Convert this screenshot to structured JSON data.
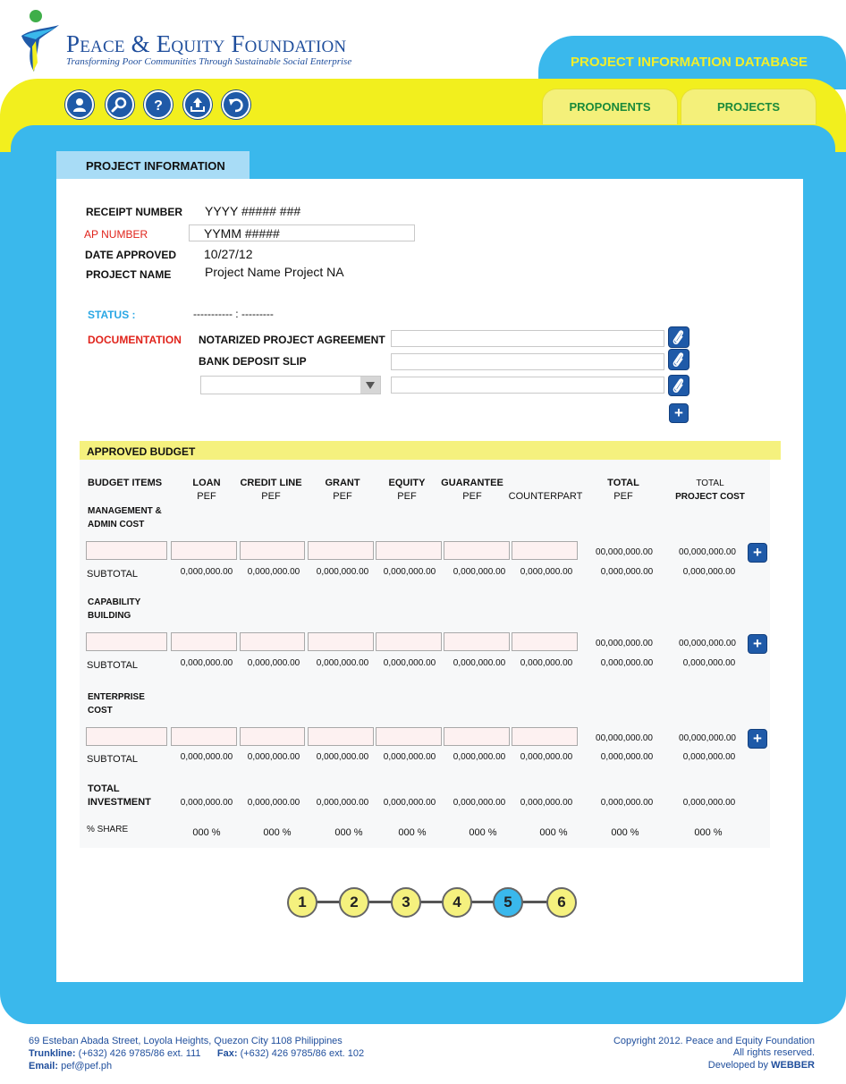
{
  "header": {
    "org_name": "Peace & Equity Foundation",
    "tagline": "Transforming Poor Communities Through Sustainable Social Enterprise",
    "db_title": "PROJECT INFORMATION DATABASE",
    "toolbar_icons": [
      "user-icon",
      "search-icon",
      "help-icon",
      "upload-icon",
      "undo-icon"
    ],
    "nav_tabs": [
      "PROPONENTS",
      "PROJECTS"
    ]
  },
  "panel": {
    "tab_label": "PROJECT INFORMATION",
    "receipt_label": "RECEIPT NUMBER",
    "receipt_value": "YYYY ##### ###",
    "ap_label": "AP NUMBER",
    "ap_value": "YYMM #####",
    "date_label": "DATE APPROVED",
    "date_value": "10/27/12",
    "project_label": "PROJECT NAME",
    "project_value": "Project Name Project NA",
    "status_label": "STATUS :",
    "status_value": "----------- : ---------",
    "documentation_label": "DOCUMENTATION",
    "doc1_label": "NOTARIZED PROJECT AGREEMENT",
    "doc2_label": "BANK DEPOSIT SLIP"
  },
  "budget": {
    "title": "APPROVED BUDGET",
    "items_header": "BUDGET ITEMS",
    "columns": [
      {
        "name": "LOAN",
        "sub": "PEF"
      },
      {
        "name": "CREDIT LINE",
        "sub": "PEF"
      },
      {
        "name": "GRANT",
        "sub": "PEF"
      },
      {
        "name": "EQUITY",
        "sub": "PEF"
      },
      {
        "name": "GUARANTEE",
        "sub": "PEF"
      },
      {
        "name": "",
        "sub": "COUNTERPART"
      },
      {
        "name": "TOTAL",
        "sub": "PEF"
      },
      {
        "name": "TOTAL",
        "sub": "PROJECT COST"
      }
    ],
    "sections": [
      {
        "line1": "MANAGEMENT &",
        "line2": "ADMIN COST"
      },
      {
        "line1": "CAPABILITY",
        "line2": "BUILDING"
      },
      {
        "line1": "ENTERPRISE",
        "line2": "COST"
      }
    ],
    "subtotal_label": "SUBTOTAL",
    "row_total": "00,000,000.00",
    "sub_value": "0,000,000.00",
    "total_label_1": "TOTAL",
    "total_label_2": "INVESTMENT",
    "share_label": "% SHARE",
    "share_value": "000 %"
  },
  "steps": [
    "1",
    "2",
    "3",
    "4",
    "5",
    "6"
  ],
  "active_step": "5",
  "footer": {
    "address": "69 Esteban Abada Street, Loyola Heights, Quezon City 1108 Philippines",
    "trunk_label": "Trunkline:",
    "trunk_value": "(+632) 426 9785/86 ext. 111",
    "fax_label": "Fax:",
    "fax_value": "(+632) 426 9785/86 ext. 102",
    "email_label": "Email:",
    "email_value": "pef@pef.ph",
    "copyright": "Copyright 2012. Peace and Equity Foundation",
    "rights": "All rights reserved.",
    "dev_label": "Developed by",
    "dev_value": "WEBBER"
  },
  "colors": {
    "blue": "#3ab8ec",
    "yellow": "#f2ef1e",
    "navy": "#1f5aa8",
    "red": "#e0231b"
  }
}
